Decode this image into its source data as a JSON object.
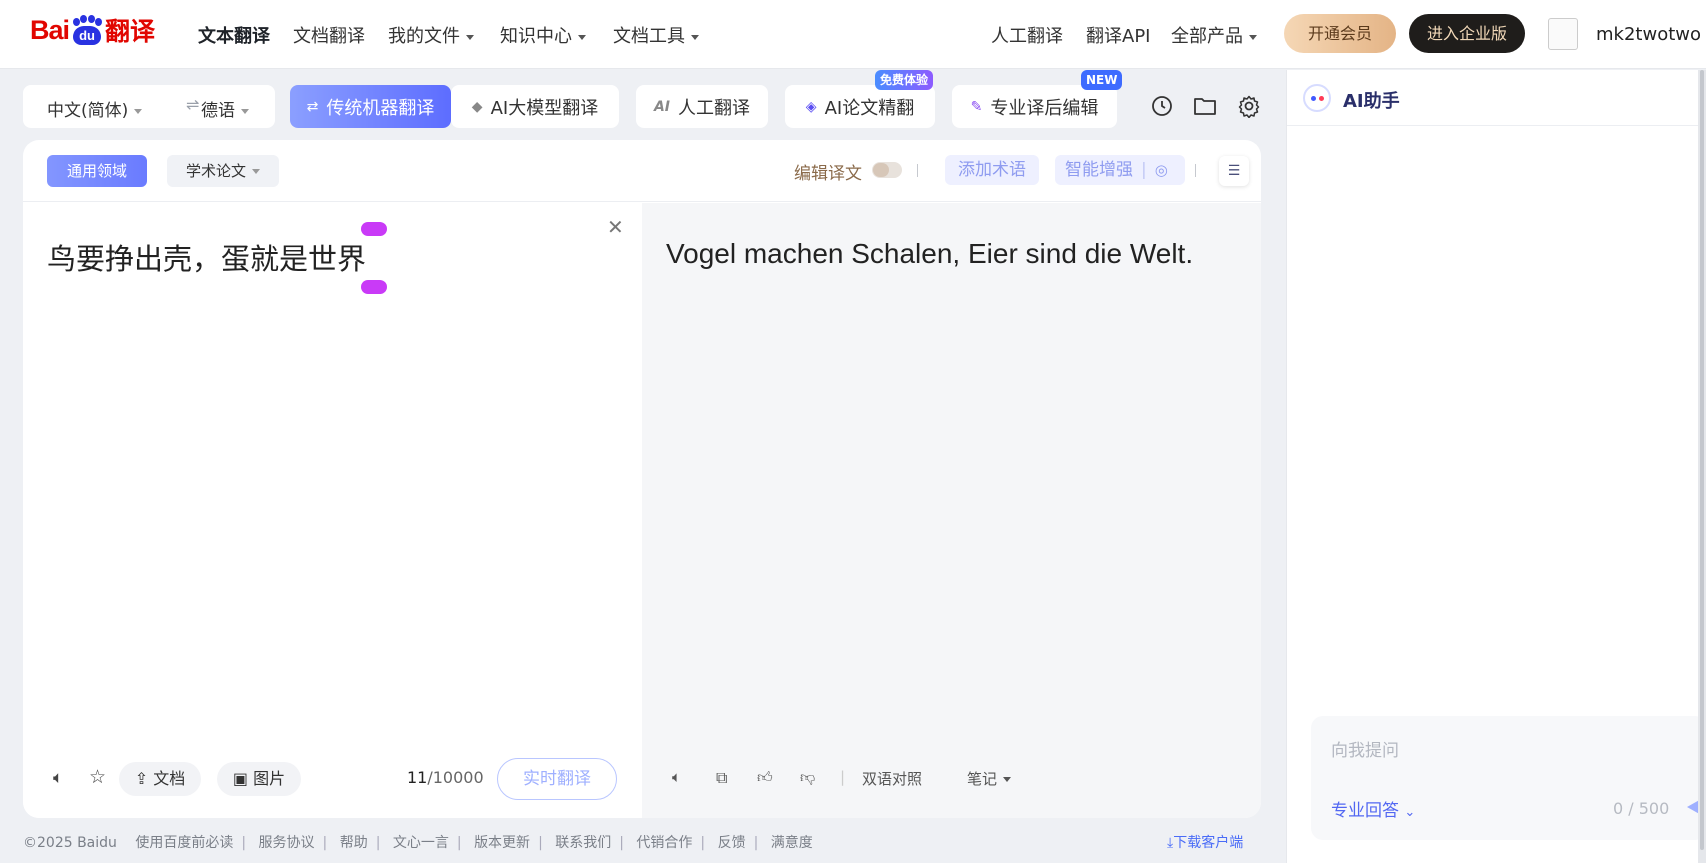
{
  "brand": {
    "bai": "Bai",
    "du": "du",
    "fy": "翻译"
  },
  "nav": {
    "items": [
      {
        "label": "文本翻译",
        "active": true
      },
      {
        "label": "文档翻译"
      },
      {
        "label": "我的文件"
      },
      {
        "label": "知识中心"
      },
      {
        "label": "文档工具"
      }
    ],
    "right": [
      "人工翻译",
      "翻译API",
      "全部产品"
    ],
    "vip": "开通会员",
    "enterprise": "进入企业版",
    "username": "mk2twotwo"
  },
  "toolbar": {
    "source_lang": "中文(简体)",
    "swap_icon": "⇌",
    "target_lang": "德语",
    "modes": [
      {
        "label": "传统机器翻译"
      },
      {
        "label": "AI大模型翻译"
      },
      {
        "label": "人工翻译"
      },
      {
        "label": "AI论文精翻",
        "badge": "免费体验"
      },
      {
        "label": "专业译后编辑",
        "badge": "NEW"
      }
    ]
  },
  "card": {
    "domains": [
      "通用领域",
      "学术论文"
    ],
    "edit_label": "编辑译文",
    "add_term": "添加术语",
    "enhance": "智能增强"
  },
  "source": {
    "text": "鸟要挣出壳，蛋就是世界",
    "doc_btn": "文档",
    "img_btn": "图片",
    "count": "11",
    "limit": "/10000",
    "realtime": "实时翻译"
  },
  "target": {
    "text": "Vogel machen Schalen, Eier sind die Welt.",
    "bilingual": "双语对照",
    "notes": "笔记"
  },
  "footer": {
    "copyright": "©2025 Baidu",
    "links": [
      "使用百度前必读",
      "服务协议",
      "帮助",
      "文心一言",
      "版本更新",
      "联系我们",
      "代销合作",
      "反馈",
      "满意度"
    ],
    "download": "下载客户端"
  },
  "ai": {
    "title": "AI助手",
    "placeholder": "向我提问",
    "mode": "专业回答",
    "count": "0 / 500"
  },
  "colors": {
    "brand_red": "#e10601",
    "brand_blue": "#2932e1",
    "accent": "#5d6dff"
  }
}
